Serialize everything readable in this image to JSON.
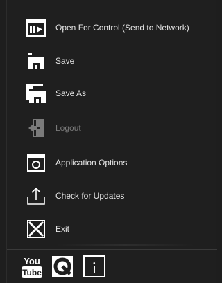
{
  "menu": {
    "items": [
      {
        "label": "Open For Control (Send to Network)",
        "icon": "send-to-network-icon",
        "disabled": false
      },
      {
        "label": "Save",
        "icon": "save-icon",
        "disabled": false
      },
      {
        "label": "Save As",
        "icon": "save-as-icon",
        "disabled": false
      },
      {
        "label": "Logout",
        "icon": "logout-icon",
        "disabled": true
      },
      {
        "label": "Application Options",
        "icon": "application-options-icon",
        "disabled": false
      },
      {
        "label": "Check for Updates",
        "icon": "check-for-updates-icon",
        "disabled": false
      },
      {
        "label": "Exit",
        "icon": "exit-icon",
        "disabled": false
      }
    ]
  },
  "footer": {
    "youtube_top": "You",
    "youtube_bottom": "Tube",
    "info_glyph": "i",
    "icons": [
      "youtube-icon",
      "q-logo-icon",
      "info-icon"
    ]
  },
  "colors": {
    "background": "#1f1f1f",
    "text": "#e6e6e6",
    "disabled_text": "#7a7a7a",
    "icon": "#ffffff"
  }
}
